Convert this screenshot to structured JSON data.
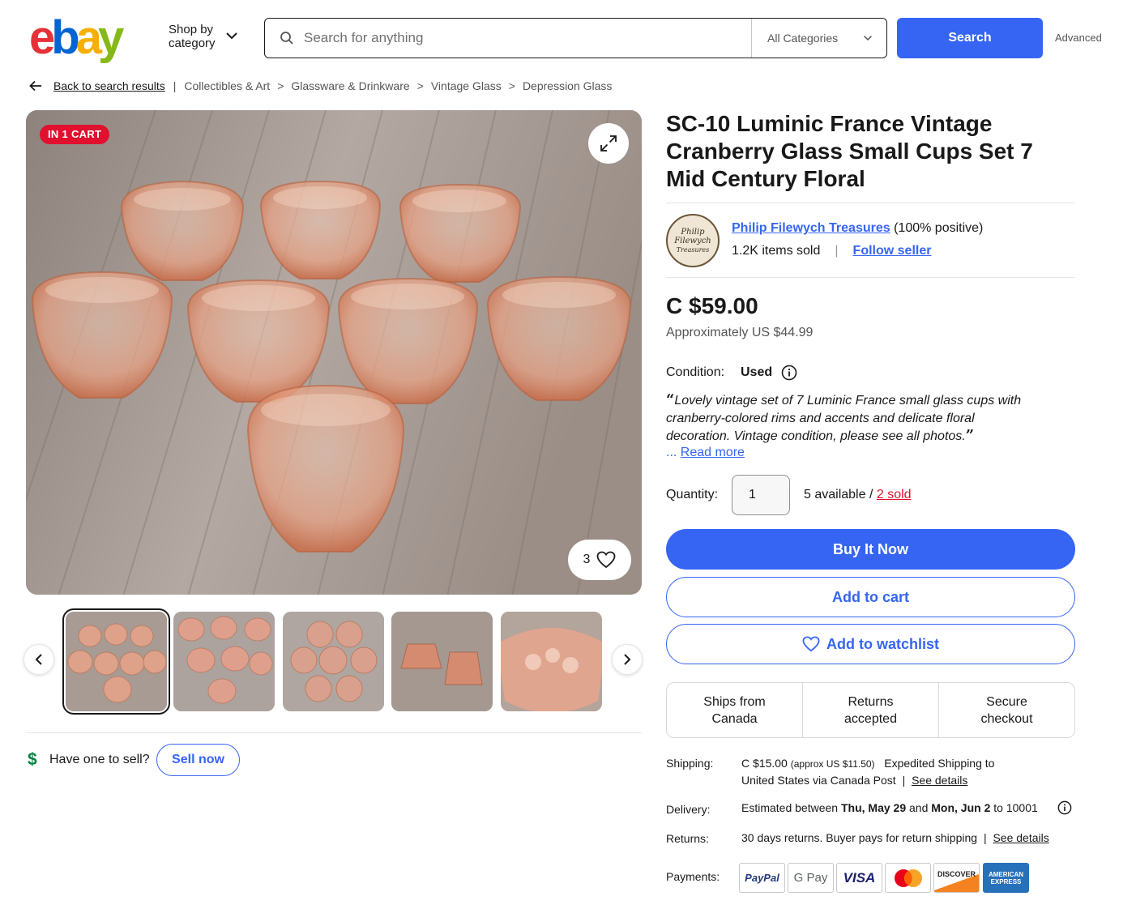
{
  "header": {
    "shop_by_line1": "Shop by",
    "shop_by_line2": "category",
    "search_placeholder": "Search for anything",
    "category_select": "All Categories",
    "search_button": "Search",
    "advanced": "Advanced"
  },
  "breadcrumb": {
    "back": "Back to search results",
    "pipe": "|",
    "separator": ">",
    "items": [
      "Collectibles & Art",
      "Glassware & Drinkware",
      "Vintage Glass",
      "Depression Glass"
    ]
  },
  "gallery": {
    "badge": "IN 1 CART",
    "watch_count": "3"
  },
  "sell": {
    "dollar": "$",
    "prompt": "Have one to sell?",
    "button": "Sell now"
  },
  "listing": {
    "title": "SC-10 Luminic France Vintage Cranberry Glass Small Cups Set 7 Mid Century Floral",
    "seller": {
      "logo_text_1": "Philip",
      "logo_text_2": "Filewych",
      "logo_text_3": "Treasures",
      "name": "Philip Filewych Treasures",
      "rating": "(100% positive)",
      "items_sold": "1.2K items sold",
      "pipe": "|",
      "follow": "Follow seller"
    },
    "price": "C $59.00",
    "approx": "Approximately US $44.99",
    "condition_label": "Condition:",
    "condition_value": "Used",
    "quote_open": "“",
    "quote_close": "”",
    "description": "Lovely vintage set of 7 Luminic France small glass cups with cranberry-colored rims and accents and delicate floral decoration. Vintage condition, please see all photos.",
    "read_more_prefix": "...",
    "read_more": "Read more",
    "quantity_label": "Quantity:",
    "quantity_value": "1",
    "available": "5 available /",
    "sold": "2 sold",
    "buy_now": "Buy It Now",
    "add_to_cart": "Add to cart",
    "add_to_watchlist": "Add to watchlist",
    "features": [
      "Ships from\nCanada",
      "Returns\naccepted",
      "Secure\ncheckout"
    ]
  },
  "details": {
    "shipping_label": "Shipping:",
    "shipping_price": "C $15.00",
    "shipping_approx": "(approx US $11.50)",
    "shipping_line1": "Expedited Shipping to",
    "shipping_line2": "United States via Canada Post",
    "see_details": "See details",
    "pipe": "|",
    "delivery_label": "Delivery:",
    "delivery_prefix": "Estimated between",
    "delivery_start": "Thu, May 29",
    "delivery_and": "and",
    "delivery_end": "Mon, Jun 2",
    "delivery_to": "to 10001",
    "returns_label": "Returns:",
    "returns_text": "30 days returns. Buyer pays for return shipping",
    "payments_label": "Payments:",
    "payments": [
      "PayPal",
      "G Pay",
      "VISA",
      "Mastercard",
      "DISCOVER",
      "AMERICAN EXPRESS"
    ]
  },
  "colors": {
    "accent": "#3665f3",
    "sold_red": "#e0102e",
    "logo_red": "#e53238",
    "logo_blue": "#0064d2",
    "logo_yellow": "#f5af02",
    "logo_green": "#86b817"
  }
}
